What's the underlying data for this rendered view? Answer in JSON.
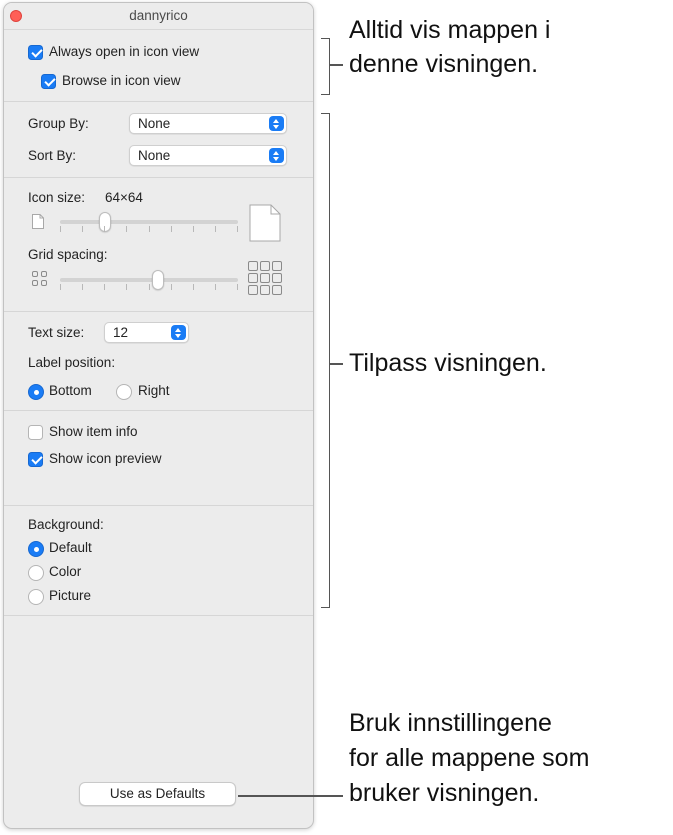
{
  "window": {
    "title": "dannyrico"
  },
  "view_options": {
    "always_open": {
      "label": "Always open in icon view",
      "checked": true
    },
    "browse": {
      "label": "Browse in icon view",
      "checked": true
    }
  },
  "group_by": {
    "label": "Group By:",
    "value": "None"
  },
  "sort_by": {
    "label": "Sort By:",
    "value": "None"
  },
  "icon_size": {
    "label": "Icon size:",
    "value": "64×64",
    "slider_fraction": 0.25
  },
  "grid_spacing": {
    "label": "Grid spacing:",
    "slider_fraction": 0.55
  },
  "text_size": {
    "label": "Text size:",
    "value": "12"
  },
  "label_position": {
    "label": "Label position:",
    "options": [
      {
        "label": "Bottom",
        "selected": true
      },
      {
        "label": "Right",
        "selected": false
      }
    ]
  },
  "show_item_info": {
    "label": "Show item info",
    "checked": false
  },
  "show_icon_preview": {
    "label": "Show icon preview",
    "checked": true
  },
  "background": {
    "label": "Background:",
    "options": [
      {
        "label": "Default",
        "selected": true
      },
      {
        "label": "Color",
        "selected": false
      },
      {
        "label": "Picture",
        "selected": false
      }
    ]
  },
  "defaults_button": {
    "label": "Use as Defaults"
  },
  "callouts": {
    "top_line1": "Alltid vis mappen i",
    "top_line2": "denne visningen.",
    "middle": "Tilpass visningen.",
    "bottom_line1": "Bruk innstillingene",
    "bottom_line2": "for alle mappene som",
    "bottom_line3": "bruker visningen."
  },
  "colors": {
    "accent": "#1a7cf5",
    "close": "#ff5f57",
    "window_bg": "#ececec"
  }
}
